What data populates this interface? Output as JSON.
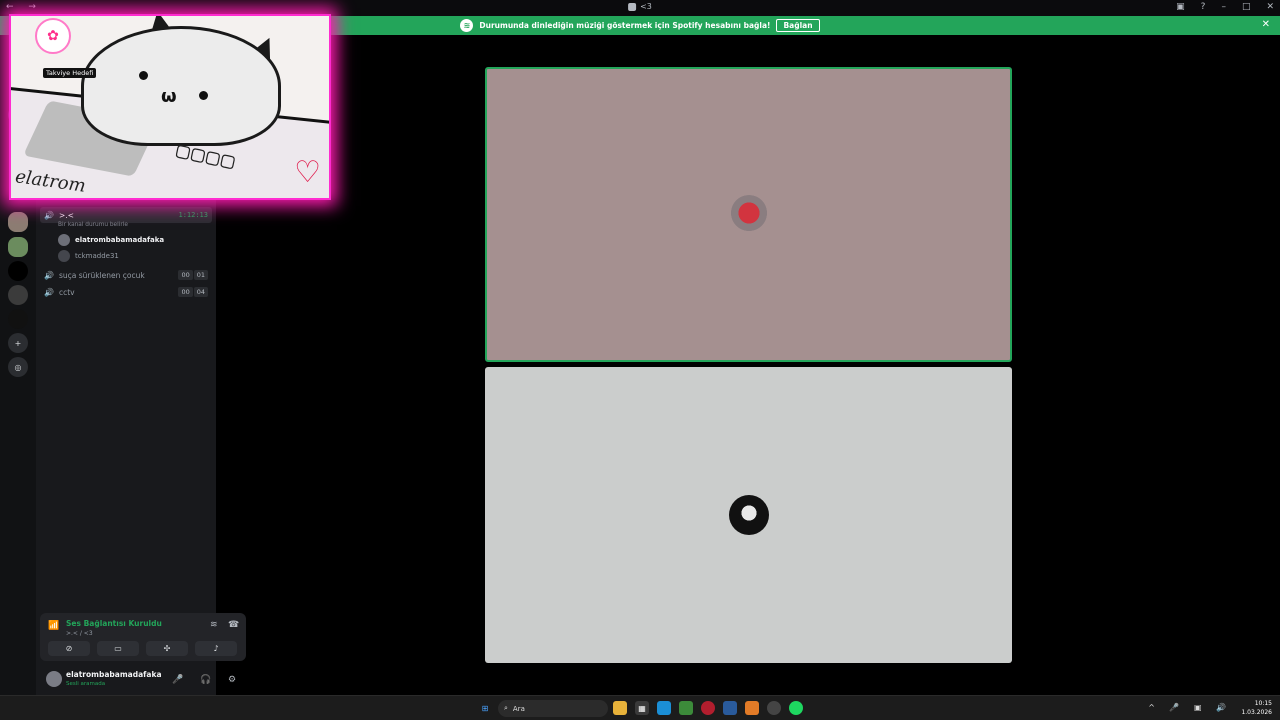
{
  "titlebar": {
    "title": "<3"
  },
  "banner": {
    "text": "Durumunda dinlediğin müziği göstermek için Spotify hesabını bağla!",
    "button": "Bağlan"
  },
  "overlay": {
    "boost_label": "Takviye Hedefi",
    "signature": "elatrom"
  },
  "channels": {
    "active": {
      "name": ">.<",
      "time": "1:12:13",
      "status_hint": "Bir kanal durumu belirle"
    },
    "members": [
      "elatrombabamadafaka",
      "tckmadde31"
    ],
    "others": [
      {
        "name": "suça sürüklenen çocuk",
        "a": "00",
        "b": "01"
      },
      {
        "name": "cctv",
        "a": "00",
        "b": "04"
      }
    ]
  },
  "voice": {
    "status": "Ses Bağlantısı Kuruldu",
    "path": ">.< / <3"
  },
  "user": {
    "name": "elatrombabamadafaka",
    "status": "Sesli aramada"
  },
  "taskbar": {
    "search": "Ara",
    "time": "10:15",
    "date": "1.03.2026"
  },
  "colors": {
    "green": "#23a55a",
    "accent_pink": "#ff2bd0"
  }
}
